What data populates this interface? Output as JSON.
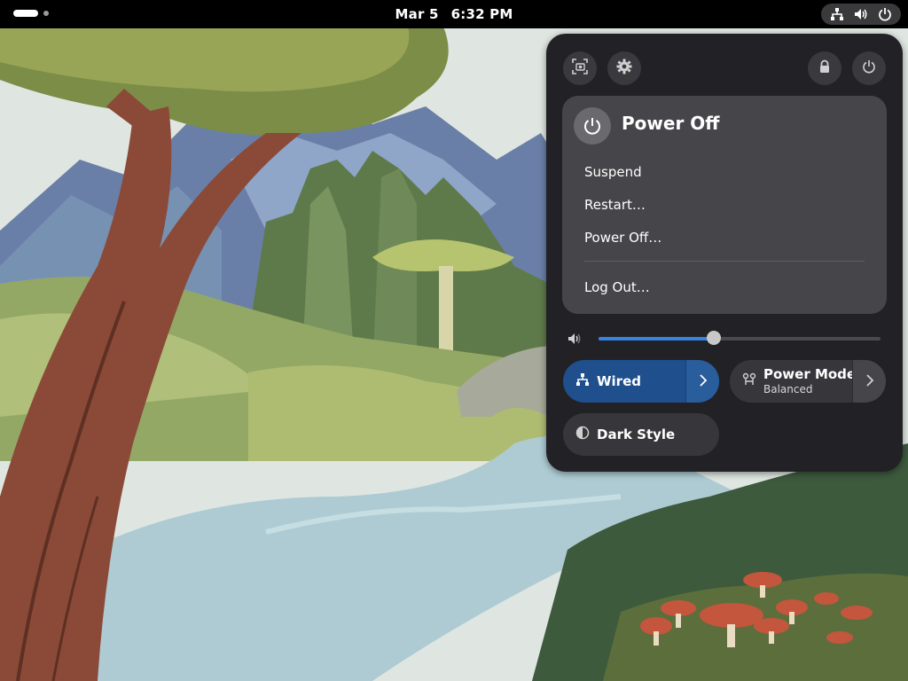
{
  "topbar": {
    "date": "Mar 5",
    "time": "6:32 PM",
    "status_icons": [
      "network-wired-icon",
      "volume-icon",
      "power-icon"
    ]
  },
  "quick_settings": {
    "top_buttons": [
      "screenshot-icon",
      "settings-icon",
      "lock-icon",
      "power-icon"
    ],
    "power_menu": {
      "title": "Power Off",
      "items": [
        "Suspend",
        "Restart…",
        "Power Off…",
        "Log Out…"
      ]
    },
    "volume": {
      "level": 0.41
    },
    "toggles": {
      "wired": {
        "label": "Wired",
        "active": true
      },
      "power_mode": {
        "label": "Power Mode",
        "subtitle": "Balanced"
      },
      "dark_style": {
        "label": "Dark Style"
      }
    }
  },
  "colors": {
    "accent": "#3584e4",
    "panel_bg": "#222226",
    "submenu_bg": "#46464a",
    "active_toggle": "#1f4f8c"
  }
}
